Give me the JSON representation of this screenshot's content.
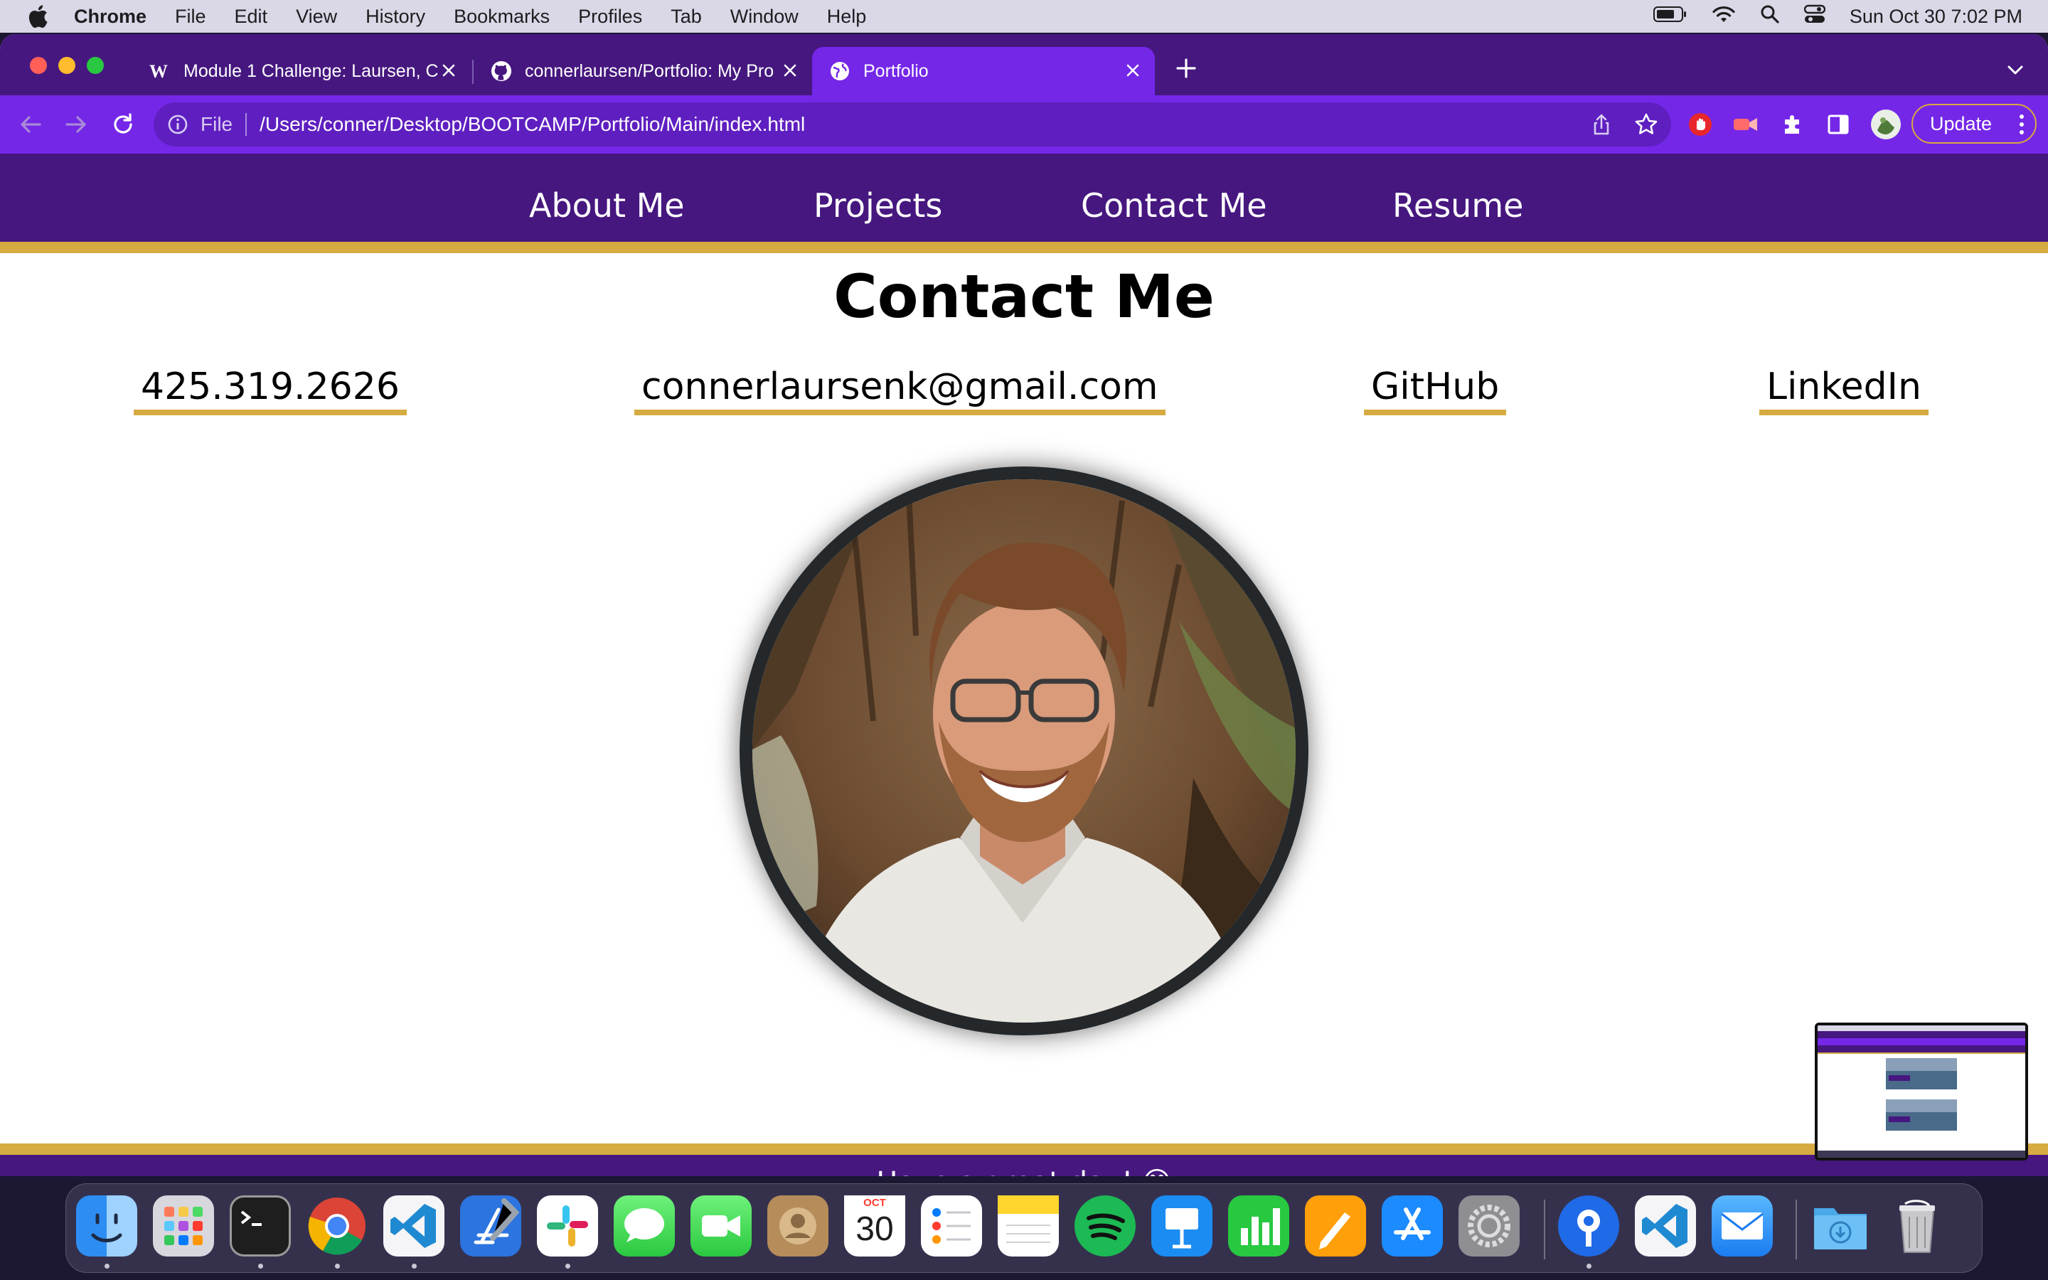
{
  "menubar": {
    "app": "Chrome",
    "items": [
      "File",
      "Edit",
      "View",
      "History",
      "Bookmarks",
      "Profiles",
      "Tab",
      "Window",
      "Help"
    ],
    "clock": "Sun Oct 30  7:02 PM"
  },
  "tabs": [
    {
      "title": "Module 1 Challenge: Laursen, C",
      "favicon": "w-icon"
    },
    {
      "title": "connerlaursen/Portfolio: My Pro",
      "favicon": "github-icon"
    },
    {
      "title": "Portfolio",
      "favicon": "globe-icon",
      "active": true
    }
  ],
  "address_bar": {
    "scheme": "File",
    "url": "/Users/conner/Desktop/BOOTCAMP/Portfolio/Main/index.html"
  },
  "update_label": "Update",
  "site": {
    "nav": [
      "About Me",
      "Projects",
      "Contact Me",
      "Resume"
    ],
    "heading": "Contact Me",
    "contacts": {
      "phone": "425.319.2626",
      "email": "connerlaursenk@gmail.com",
      "github": "GitHub",
      "linkedin": "LinkedIn"
    },
    "footer": "Have a great day! 😊"
  },
  "dock": {
    "calendar_month": "OCT",
    "calendar_day": "30"
  },
  "colors": {
    "purple": "#46177f",
    "accent_purple": "#7527e8",
    "gold": "#d6ab41"
  }
}
